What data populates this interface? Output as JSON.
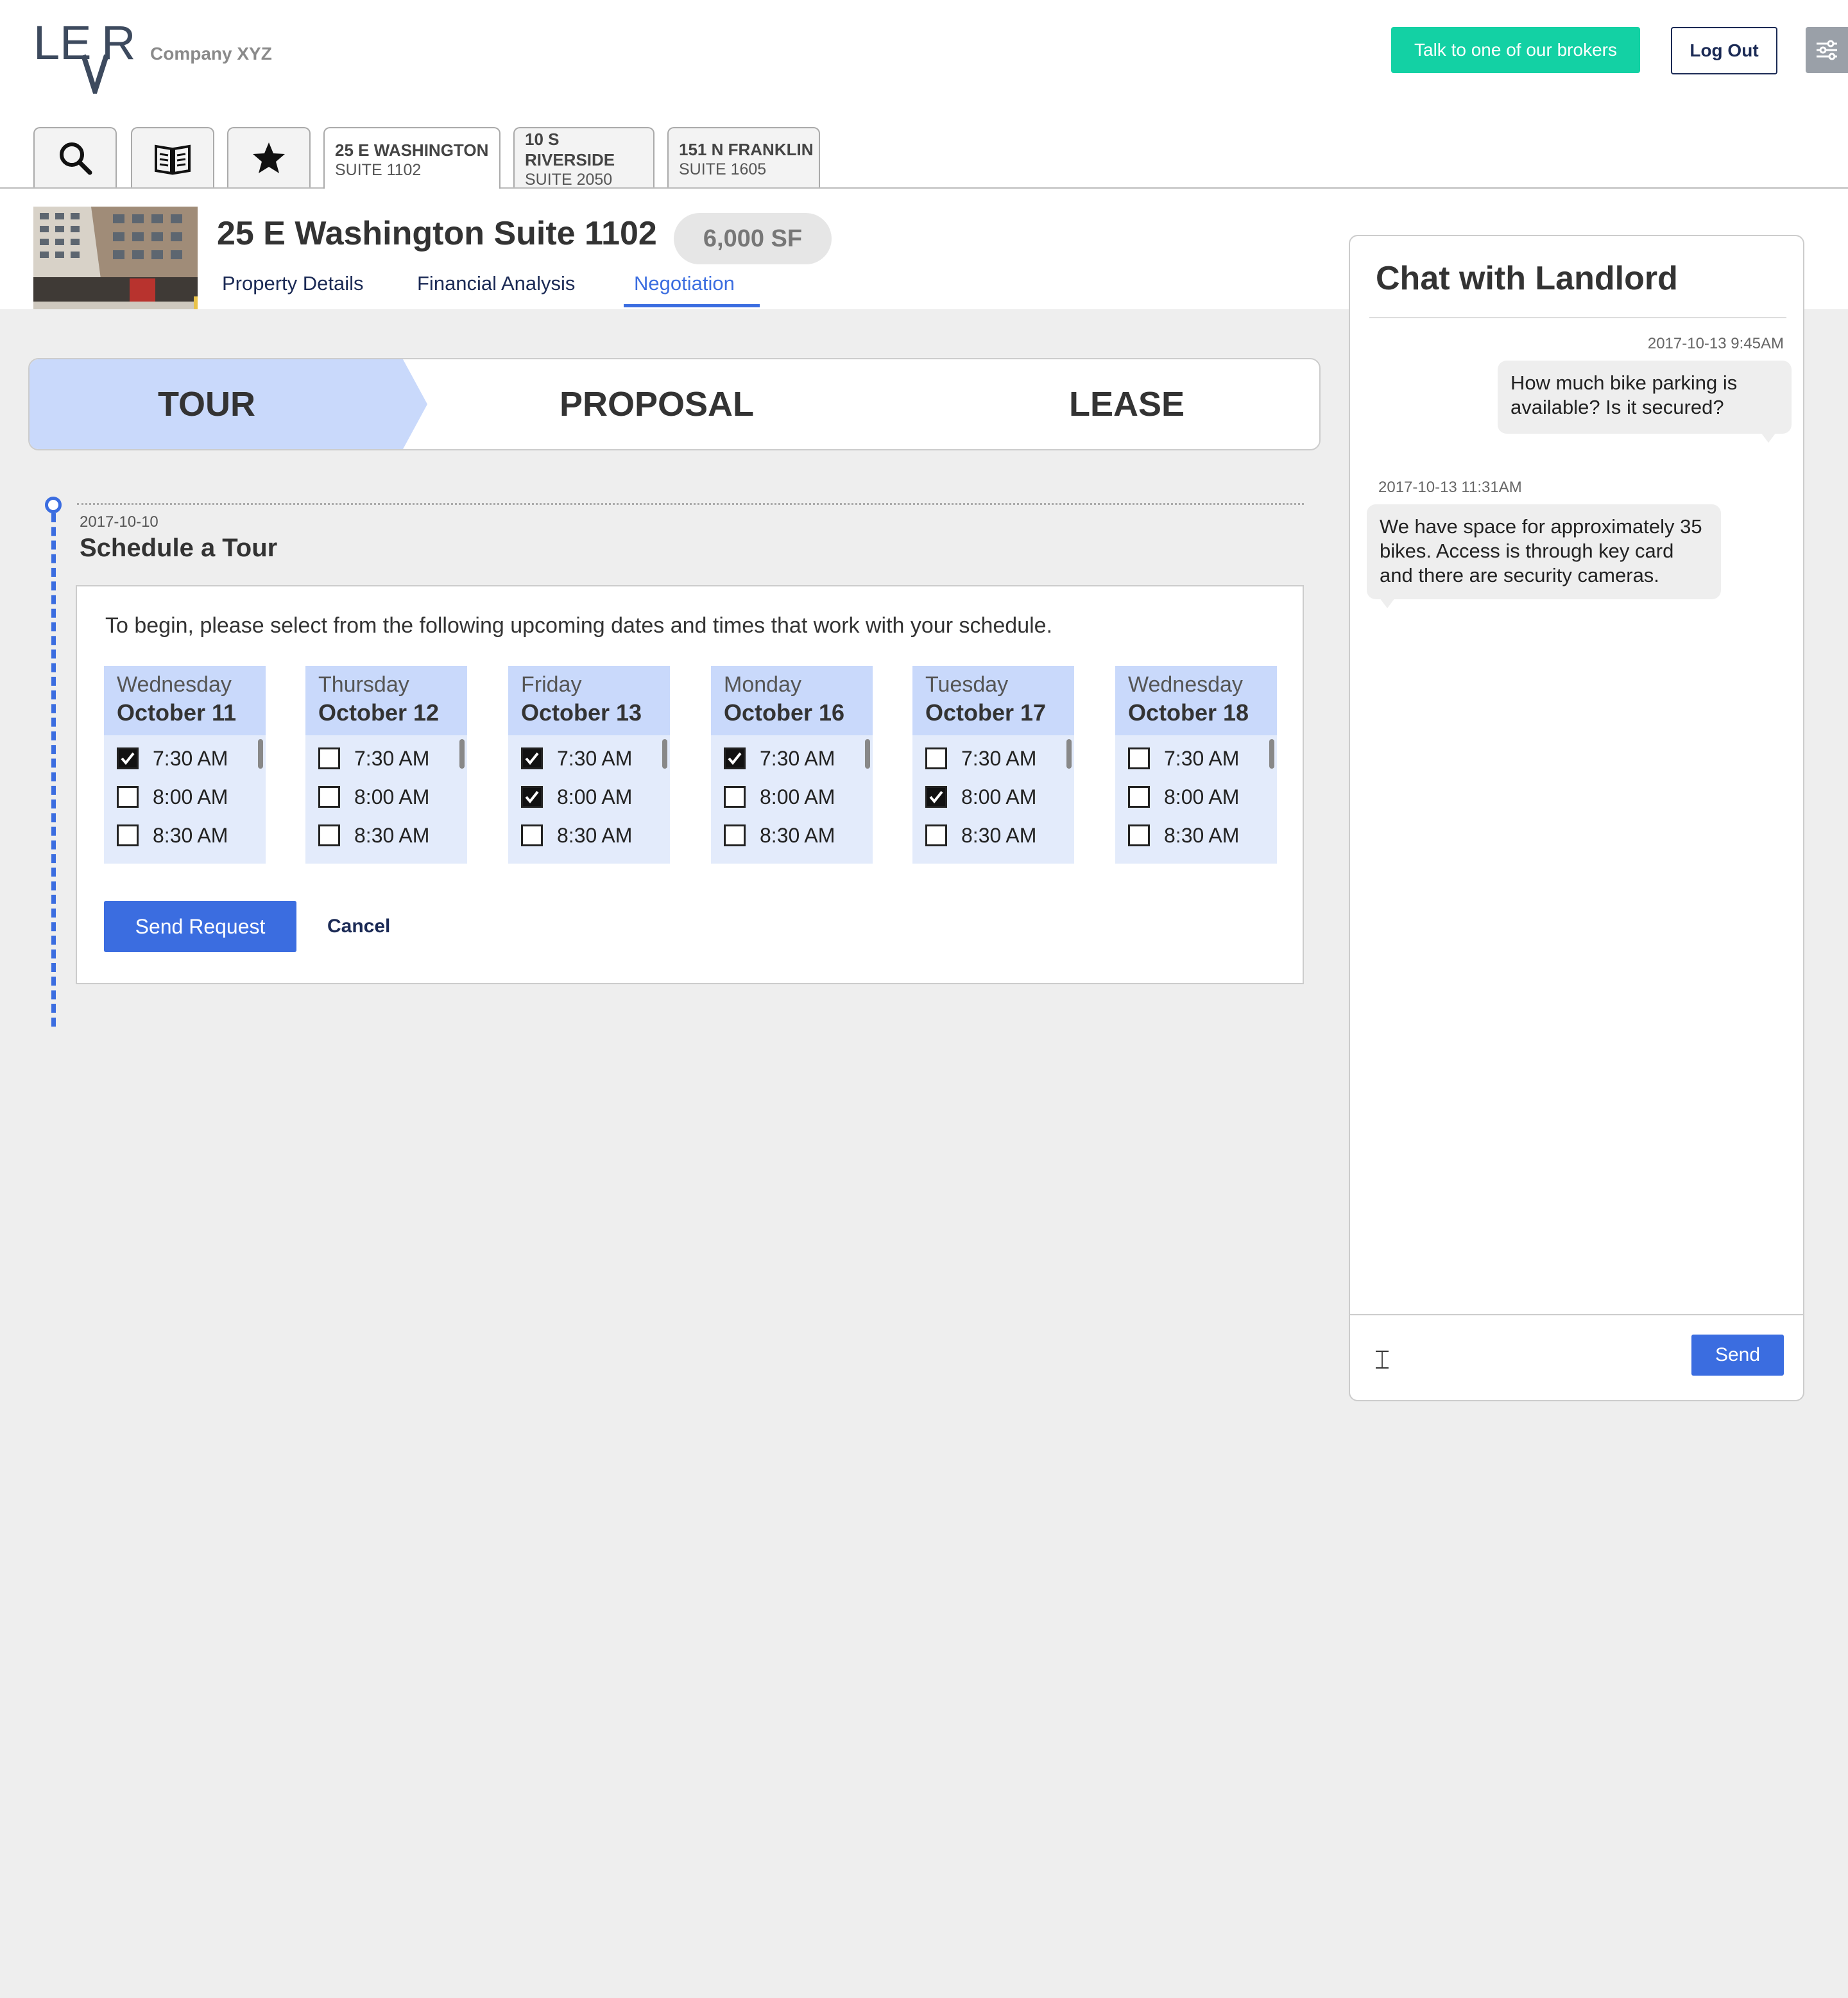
{
  "header": {
    "logo_text": "LEVR",
    "company": "Company XYZ",
    "broker_button": "Talk to one of our brokers",
    "logout_button": "Log Out"
  },
  "tabs": {
    "icons": [
      "search-icon",
      "book-icon",
      "star-icon"
    ],
    "properties": [
      {
        "line1": "25 E WASHINGTON",
        "line2": "SUITE 1102",
        "active": true
      },
      {
        "line1": "10 S RIVERSIDE",
        "line2": "SUITE 2050",
        "active": false
      },
      {
        "line1": "151 N FRANKLIN",
        "line2": "SUITE 1605",
        "active": false
      }
    ]
  },
  "property": {
    "title": "25 E Washington Suite 1102",
    "size_badge": "6,000 SF",
    "subtabs": [
      "Property Details",
      "Financial Analysis",
      "Negotiation"
    ],
    "active_subtab": "Negotiation"
  },
  "stepper": {
    "steps": [
      "TOUR",
      "PROPOSAL",
      "LEASE"
    ],
    "active_step": "TOUR"
  },
  "event": {
    "date": "2017-10-10",
    "title": "Schedule a Tour",
    "intro": "To begin, please select from the following upcoming dates and times that work with your schedule.",
    "days": [
      {
        "weekday": "Wednesday",
        "date": "October 11",
        "slots": [
          {
            "time": "7:30 AM",
            "checked": true
          },
          {
            "time": "8:00 AM",
            "checked": false
          },
          {
            "time": "8:30 AM",
            "checked": false
          }
        ]
      },
      {
        "weekday": "Thursday",
        "date": "October 12",
        "slots": [
          {
            "time": "7:30 AM",
            "checked": false
          },
          {
            "time": "8:00 AM",
            "checked": false
          },
          {
            "time": "8:30 AM",
            "checked": false
          }
        ]
      },
      {
        "weekday": "Friday",
        "date": "October 13",
        "slots": [
          {
            "time": "7:30 AM",
            "checked": true
          },
          {
            "time": "8:00 AM",
            "checked": true
          },
          {
            "time": "8:30 AM",
            "checked": false
          }
        ]
      },
      {
        "weekday": "Monday",
        "date": "October 16",
        "slots": [
          {
            "time": "7:30 AM",
            "checked": true
          },
          {
            "time": "8:00 AM",
            "checked": false
          },
          {
            "time": "8:30 AM",
            "checked": false
          }
        ]
      },
      {
        "weekday": "Tuesday",
        "date": "October 17",
        "slots": [
          {
            "time": "7:30 AM",
            "checked": false
          },
          {
            "time": "8:00 AM",
            "checked": true
          },
          {
            "time": "8:30 AM",
            "checked": false
          }
        ]
      },
      {
        "weekday": "Wednesday",
        "date": "October 18",
        "slots": [
          {
            "time": "7:30 AM",
            "checked": false
          },
          {
            "time": "8:00 AM",
            "checked": false
          },
          {
            "time": "8:30 AM",
            "checked": false
          }
        ]
      }
    ],
    "send_button": "Send Request",
    "cancel_button": "Cancel"
  },
  "chat": {
    "title": "Chat with Landlord",
    "messages": [
      {
        "timestamp": "2017-10-13 9:45AM",
        "text": "How much bike parking is available? Is it secured?",
        "from": "me"
      },
      {
        "timestamp": "2017-10-13 11:31AM",
        "text": "We have space for approximately 35 bikes. Access is through key card and there are security cameras.",
        "from": "landlord"
      }
    ],
    "input_value": "",
    "send_button": "Send"
  },
  "colors": {
    "accent": "#3b6de0",
    "broker_green": "#13d1a4",
    "navy": "#1b2a55",
    "active_step": "#c9d9fb",
    "day_bg": "#e3ebfb"
  }
}
